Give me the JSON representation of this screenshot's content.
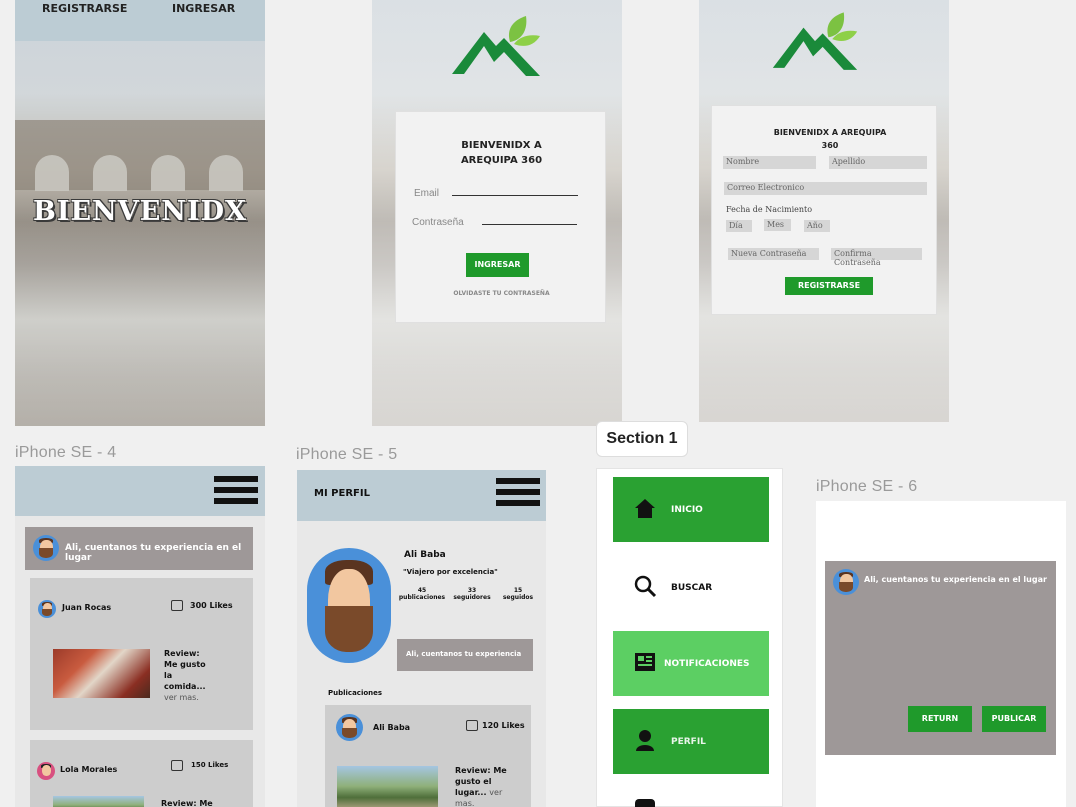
{
  "screen1": {
    "nav": {
      "register": "REGISTRARSE",
      "login": "INGRESAR"
    },
    "headline": "BIENVENIDX"
  },
  "login": {
    "title_line1": "BIENVENIDX A",
    "title_line2": "AREQUIPA 360",
    "email_label": "Email",
    "password_label": "Contraseña",
    "submit_label": "INGRESAR",
    "forgot_label": "OLVIDASTE TU CONTRASEÑA"
  },
  "register": {
    "title_line1": "BIENVENIDX A AREQUIPA",
    "title_line2": "360",
    "first_name": "Nombre",
    "last_name": "Apellido",
    "email": "Correo Electronico",
    "birthdate_label": "Fecha de Nacimiento",
    "day": "Día",
    "month": "Mes",
    "year": "Año",
    "new_password": "Nueva Contraseña",
    "confirm_password": "Confirma Contraseña",
    "submit_label": "REGISTRARSE"
  },
  "frames": {
    "se4": "iPhone SE - 4",
    "se5": "iPhone SE - 5",
    "section": "Section 1",
    "se6": "iPhone SE - 6"
  },
  "feed": {
    "prompt": "Ali, cuentanos tu experiencia en el lugar",
    "posts": [
      {
        "user": "Juan Rocas",
        "likes": "300 Likes",
        "review_lines": [
          "Review:",
          "Me gusto",
          "la",
          "comida..."
        ],
        "more": "ver mas."
      },
      {
        "user": "Lola Morales",
        "likes": "150 Likes",
        "review_lines": [
          "Review: Me"
        ],
        "more": ""
      }
    ]
  },
  "profile": {
    "header": "MI PERFIL",
    "name": "Ali Baba",
    "motto": "\"Viajero por excelencia\"",
    "stats": [
      {
        "count": "45",
        "label": "publicaciones"
      },
      {
        "count": "33",
        "label": "seguidores"
      },
      {
        "count": "15",
        "label": "seguidos"
      }
    ],
    "prompt": "Ali, cuentanos tu experiencia",
    "posts_title": "Publicaciones",
    "post": {
      "user": "Ali Baba",
      "likes": "120 Likes",
      "review_lines": [
        "Review: Me",
        "gusto el",
        "lugar..."
      ],
      "more_inline": "ver",
      "more": "mas."
    }
  },
  "nav_menu": {
    "items": [
      {
        "label": "INICIO",
        "icon": "home-icon",
        "active": true
      },
      {
        "label": "BUSCAR",
        "icon": "search-icon",
        "active": false
      },
      {
        "label": "NOTIFICACIONES",
        "icon": "newspaper-icon",
        "active": true
      },
      {
        "label": "PERFIL",
        "icon": "user-icon",
        "active": true
      }
    ]
  },
  "compose": {
    "prompt": "Ali, cuentanos tu experiencia en el lugar",
    "return_label": "RETURN",
    "publish_label": "PUBLICAR"
  },
  "colors": {
    "green": "#1f9a2b",
    "light_green": "#5ccf63",
    "header_blue": "#bcccd4",
    "prompt_gray": "#9e9898"
  }
}
